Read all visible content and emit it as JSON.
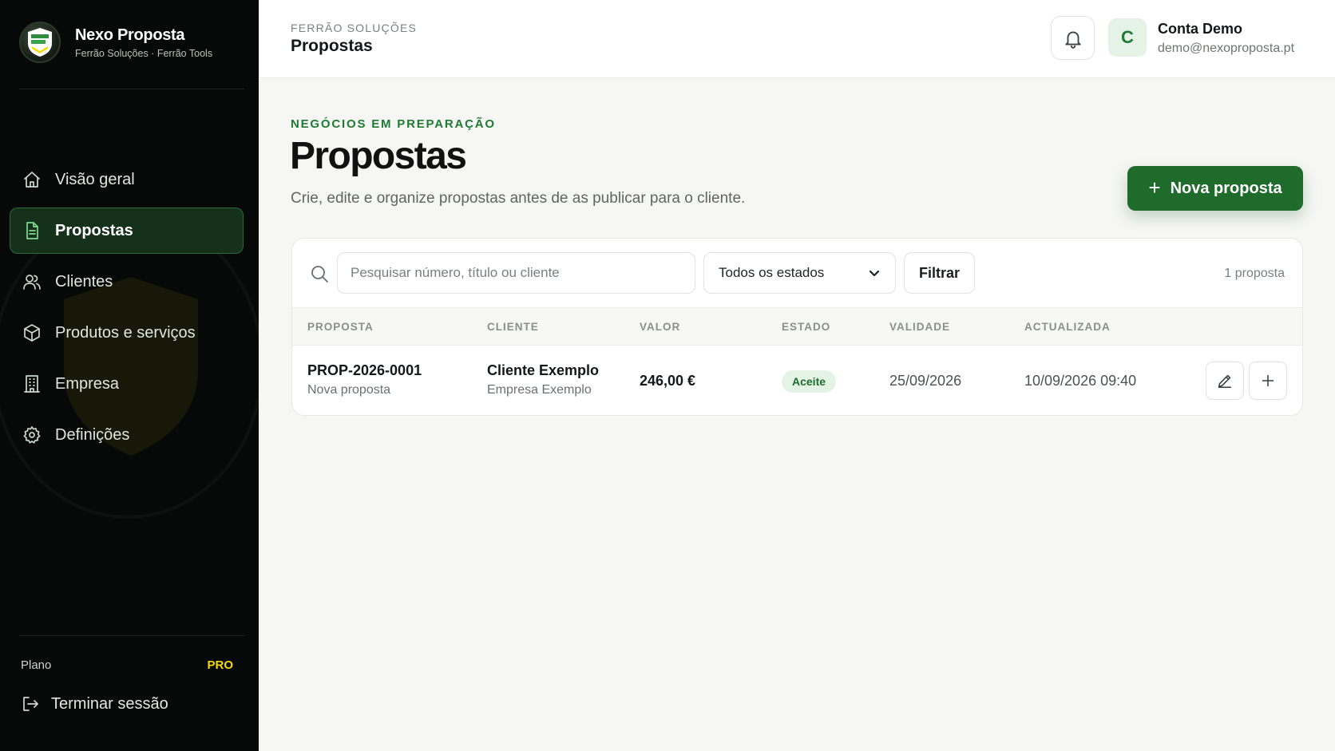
{
  "brand": {
    "title": "Nexo Proposta",
    "subtitle": "Ferrão Soluções · Ferrão Tools"
  },
  "sidebar": {
    "items": [
      {
        "label": "Visão geral",
        "icon": "home-icon"
      },
      {
        "label": "Propostas",
        "icon": "document-icon",
        "active": true
      },
      {
        "label": "Clientes",
        "icon": "users-icon"
      },
      {
        "label": "Produtos e serviços",
        "icon": "box-icon"
      },
      {
        "label": "Empresa",
        "icon": "building-icon"
      },
      {
        "label": "Definições",
        "icon": "gear-icon"
      }
    ],
    "plan_label": "Plano",
    "plan_value": "PRO",
    "logout_label": "Terminar sessão"
  },
  "topbar": {
    "kicker": "FERRÃO SOLUÇÕES",
    "title": "Propostas",
    "avatar_initial": "C",
    "user_name": "Conta Demo",
    "user_email": "demo@nexoproposta.pt"
  },
  "main": {
    "kicker": "NEGÓCIOS EM PREPARAÇÃO",
    "title": "Propostas",
    "subtitle": "Crie, edite e organize propostas antes de as publicar para o cliente.",
    "new_button": "Nova proposta"
  },
  "filters": {
    "search_placeholder": "Pesquisar número, título ou cliente",
    "status_selected": "Todos os estados",
    "filter_button": "Filtrar",
    "count": "1 proposta"
  },
  "table": {
    "columns": [
      "PROPOSTA",
      "CLIENTE",
      "VALOR",
      "ESTADO",
      "VALIDADE",
      "ACTUALIZADA"
    ],
    "rows": [
      {
        "number": "PROP-2026-0001",
        "title": "Nova proposta",
        "client": "Cliente Exemplo",
        "company": "Empresa Exemplo",
        "value": "246,00 €",
        "status": "Aceite",
        "validity": "25/09/2026",
        "updated": "10/09/2026 09:40"
      }
    ]
  },
  "colors": {
    "accent": "#1f6b2c",
    "accent_text": "#1f7a33",
    "sidebar_bg": "#070908",
    "plan_badge": "#f5d90a",
    "status_badge_bg": "#e3f4e5"
  }
}
